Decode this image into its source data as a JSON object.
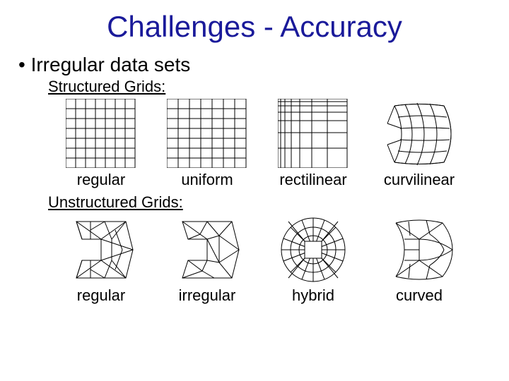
{
  "title": "Challenges - Accuracy",
  "bullet": "• Irregular data sets",
  "structured": {
    "heading": "Structured Grids:",
    "captions": [
      "regular",
      "uniform",
      "rectilinear",
      "curvilinear"
    ]
  },
  "unstructured": {
    "heading": "Unstructured Grids:",
    "captions": [
      "regular",
      "irregular",
      "hybrid",
      "curved"
    ]
  }
}
